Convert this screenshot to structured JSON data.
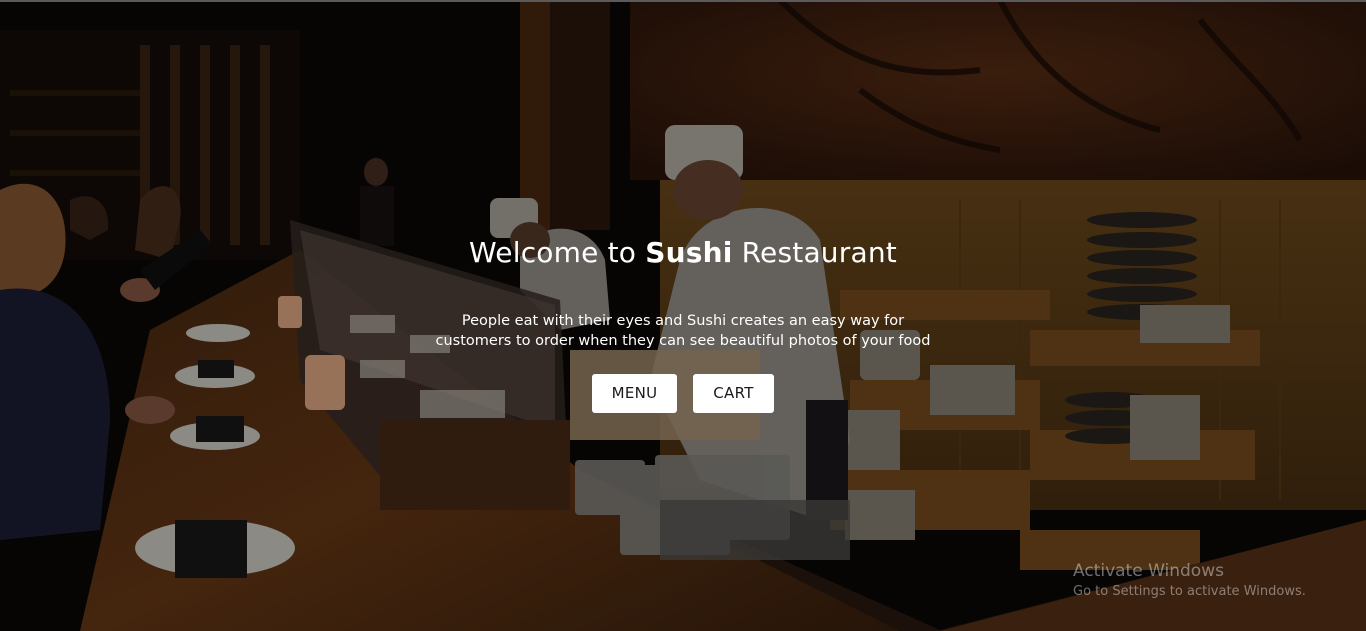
{
  "hero": {
    "title_prefix": "Welcome to",
    "title_bold": "Sushi",
    "title_suffix": "Restaurant",
    "tagline_line1": "People eat with their eyes and Sushi creates an easy way for",
    "tagline_line2": "customers to order when they can see beautiful photos of your food"
  },
  "buttons": {
    "menu_label": "MENU",
    "cart_label": "CART"
  },
  "watermark": {
    "title": "Activate Windows",
    "subtitle": "Go to Settings to activate Windows."
  }
}
